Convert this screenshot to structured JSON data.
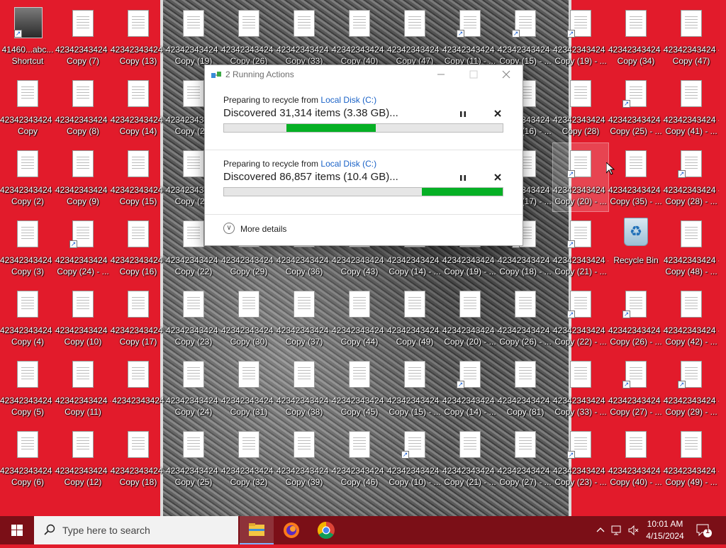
{
  "desktop": {
    "icons": [
      {
        "label": "41460...abc...\nShortcut",
        "col": 0,
        "row": 0,
        "type": "app"
      },
      {
        "label": "42342343424 -\nCopy (7)",
        "col": 1,
        "row": 0
      },
      {
        "label": "42342343424 -\nCopy (13)",
        "col": 2,
        "row": 0
      },
      {
        "label": "42342343424 -\nCopy (19)",
        "col": 3,
        "row": 0
      },
      {
        "label": "42342343424 -\nCopy (26)",
        "col": 4,
        "row": 0
      },
      {
        "label": "42342343424 -\nCopy (33)",
        "col": 5,
        "row": 0
      },
      {
        "label": "42342343424 -\nCopy (40)",
        "col": 6,
        "row": 0
      },
      {
        "label": "42342343424 -\nCopy (47)",
        "col": 7,
        "row": 0
      },
      {
        "label": "42342343424 -\nCopy (11) - ...",
        "col": 8,
        "row": 0,
        "shortcut": true
      },
      {
        "label": "42342343424 -\nCopy (15) - ...",
        "col": 9,
        "row": 0,
        "shortcut": true
      },
      {
        "label": "42342343424 -\nCopy (19) - ...",
        "col": 10,
        "row": 0,
        "shortcut": true
      },
      {
        "label": "42342343424 -\nCopy (34)",
        "col": 11,
        "row": 0
      },
      {
        "label": "42342343424 -\nCopy (47)",
        "col": 12,
        "row": 0
      },
      {
        "label": "42342343424 -\nCopy",
        "col": 0,
        "row": 1
      },
      {
        "label": "42342343424 -\nCopy (8)",
        "col": 1,
        "row": 1
      },
      {
        "label": "42342343424 -\nCopy (14)",
        "col": 2,
        "row": 1
      },
      {
        "label": "42342343424 -\nCopy (20)",
        "col": 3,
        "row": 1
      },
      {
        "label": "42342343424 -\nCopy (16) - ...",
        "col": 9,
        "row": 1
      },
      {
        "label": "42342343424 -\nCopy (28)",
        "col": 10,
        "row": 1
      },
      {
        "label": "42342343424 -\nCopy (25) - ...",
        "col": 11,
        "row": 1,
        "shortcut": true
      },
      {
        "label": "42342343424 -\nCopy (41) - ...",
        "col": 12,
        "row": 1
      },
      {
        "label": "42342343424 -\nCopy (2)",
        "col": 0,
        "row": 2
      },
      {
        "label": "42342343424 -\nCopy (9)",
        "col": 1,
        "row": 2
      },
      {
        "label": "42342343424 -\nCopy (15)",
        "col": 2,
        "row": 2
      },
      {
        "label": "42342343424 -\nCopy (21)",
        "col": 3,
        "row": 2
      },
      {
        "label": "42342343424 -\nCopy (17) - ...",
        "col": 9,
        "row": 2
      },
      {
        "label": "42342343424 -\nCopy (20) - ...",
        "col": 10,
        "row": 2,
        "shortcut": true,
        "selected": true
      },
      {
        "label": "42342343424 -\nCopy (35) - ...",
        "col": 11,
        "row": 2
      },
      {
        "label": "42342343424 -\nCopy (28) - ...",
        "col": 12,
        "row": 2,
        "shortcut": true
      },
      {
        "label": "42342343424 -\nCopy (3)",
        "col": 0,
        "row": 3
      },
      {
        "label": "42342343424 -\nCopy (24) - ...",
        "col": 1,
        "row": 3,
        "shortcut": true
      },
      {
        "label": "42342343424 -\nCopy (16)",
        "col": 2,
        "row": 3
      },
      {
        "label": "42342343424 -\nCopy (22)",
        "col": 3,
        "row": 3
      },
      {
        "label": "42342343424 -\nCopy (29)",
        "col": 4,
        "row": 3
      },
      {
        "label": "42342343424 -\nCopy (36)",
        "col": 5,
        "row": 3
      },
      {
        "label": "42342343424 -\nCopy (43)",
        "col": 6,
        "row": 3
      },
      {
        "label": "42342343424 -\nCopy (14) - ...",
        "col": 7,
        "row": 3
      },
      {
        "label": "42342343424 -\nCopy (19) - ...",
        "col": 8,
        "row": 3
      },
      {
        "label": "42342343424 -\nCopy (18) - ...",
        "col": 9,
        "row": 3,
        "shortcut": true
      },
      {
        "label": "42342343424 -\nCopy (21) - ...",
        "col": 10,
        "row": 3,
        "shortcut": true
      },
      {
        "label": "Recycle Bin",
        "col": 11,
        "row": 3,
        "type": "recycle"
      },
      {
        "label": "42342343424 -\nCopy (48) - ...",
        "col": 12,
        "row": 3
      },
      {
        "label": "42342343424 -\nCopy (4)",
        "col": 0,
        "row": 4
      },
      {
        "label": "42342343424 -\nCopy (10)",
        "col": 1,
        "row": 4
      },
      {
        "label": "42342343424 -\nCopy (17)",
        "col": 2,
        "row": 4
      },
      {
        "label": "42342343424 -\nCopy (23)",
        "col": 3,
        "row": 4
      },
      {
        "label": "42342343424 -\nCopy (30)",
        "col": 4,
        "row": 4
      },
      {
        "label": "42342343424 -\nCopy (37)",
        "col": 5,
        "row": 4
      },
      {
        "label": "42342343424 -\nCopy (44)",
        "col": 6,
        "row": 4
      },
      {
        "label": "42342343424 -\nCopy (49)",
        "col": 7,
        "row": 4
      },
      {
        "label": "42342343424 -\nCopy (20) - ...",
        "col": 8,
        "row": 4
      },
      {
        "label": "42342343424 -\nCopy (26) - ...",
        "col": 9,
        "row": 4
      },
      {
        "label": "42342343424 -\nCopy (22) - ...",
        "col": 10,
        "row": 4,
        "shortcut": true
      },
      {
        "label": "42342343424 -\nCopy (26) - ...",
        "col": 11,
        "row": 4,
        "shortcut": true
      },
      {
        "label": "42342343424 -\nCopy (42) - ...",
        "col": 12,
        "row": 4
      },
      {
        "label": "42342343424 -\nCopy (5)",
        "col": 0,
        "row": 5
      },
      {
        "label": "42342343424 -\nCopy (11)",
        "col": 1,
        "row": 5
      },
      {
        "label": "42342343424",
        "col": 2,
        "row": 5
      },
      {
        "label": "42342343424 -\nCopy (24)",
        "col": 3,
        "row": 5
      },
      {
        "label": "42342343424 -\nCopy (31)",
        "col": 4,
        "row": 5
      },
      {
        "label": "42342343424 -\nCopy (38)",
        "col": 5,
        "row": 5
      },
      {
        "label": "42342343424 -\nCopy (45)",
        "col": 6,
        "row": 5
      },
      {
        "label": "42342343424 -\nCopy (15) - ...",
        "col": 7,
        "row": 5
      },
      {
        "label": "42342343424 -\nCopy (14) - ...",
        "col": 8,
        "row": 5,
        "shortcut": true
      },
      {
        "label": "42342343424 -\nCopy (81)",
        "col": 9,
        "row": 5
      },
      {
        "label": "42342343424 -\nCopy (33) - ...",
        "col": 10,
        "row": 5
      },
      {
        "label": "42342343424 -\nCopy (27) - ...",
        "col": 11,
        "row": 5,
        "shortcut": true
      },
      {
        "label": "42342343424 -\nCopy (29) - ...",
        "col": 12,
        "row": 5,
        "shortcut": true
      },
      {
        "label": "42342343424 -\nCopy (6)",
        "col": 0,
        "row": 6
      },
      {
        "label": "42342343424 -\nCopy (12)",
        "col": 1,
        "row": 6
      },
      {
        "label": "42342343424 -\nCopy (18)",
        "col": 2,
        "row": 6
      },
      {
        "label": "42342343424 -\nCopy (25)",
        "col": 3,
        "row": 6
      },
      {
        "label": "42342343424 -\nCopy (32)",
        "col": 4,
        "row": 6
      },
      {
        "label": "42342343424 -\nCopy (39)",
        "col": 5,
        "row": 6
      },
      {
        "label": "42342343424 -\nCopy (46)",
        "col": 6,
        "row": 6
      },
      {
        "label": "42342343424 -\nCopy (10) - ...",
        "col": 7,
        "row": 6,
        "shortcut": true
      },
      {
        "label": "42342343424 -\nCopy (21) - ...",
        "col": 8,
        "row": 6
      },
      {
        "label": "42342343424 -\nCopy (27) - ...",
        "col": 9,
        "row": 6
      },
      {
        "label": "42342343424 -\nCopy (23) - ...",
        "col": 10,
        "row": 6,
        "shortcut": true
      },
      {
        "label": "42342343424 -\nCopy (40) - ...",
        "col": 11,
        "row": 6
      },
      {
        "label": "42342343424 -\nCopy (49) - ...",
        "col": 12,
        "row": 6
      }
    ]
  },
  "dialog": {
    "title": "2 Running Actions",
    "minimize_icon": "minimize-icon",
    "maximize_icon": "maximize-icon",
    "close_icon": "close-icon",
    "operations": [
      {
        "source_prefix": "Preparing to recycle from ",
        "source_link": "Local Disk (C:)",
        "status": "Discovered 31,314 items (3.38 GB)...",
        "progress_start": 0.225,
        "progress_end": 0.545
      },
      {
        "source_prefix": "Preparing to recycle from ",
        "source_link": "Local Disk (C:)",
        "status": "Discovered 86,857 items (10.4 GB)...",
        "progress_start": 0.71,
        "progress_end": 1.0
      }
    ],
    "more_details": "More details"
  },
  "taskbar": {
    "search_placeholder": "Type here to search",
    "apps": [
      "file-explorer-icon",
      "firefox-icon",
      "chrome-icon"
    ],
    "time": "10:01 AM",
    "date": "4/15/2024",
    "notification_count": "1"
  },
  "colors": {
    "accent": "#06b025",
    "desktop": "#e21b2b",
    "link": "#1a62c7"
  }
}
